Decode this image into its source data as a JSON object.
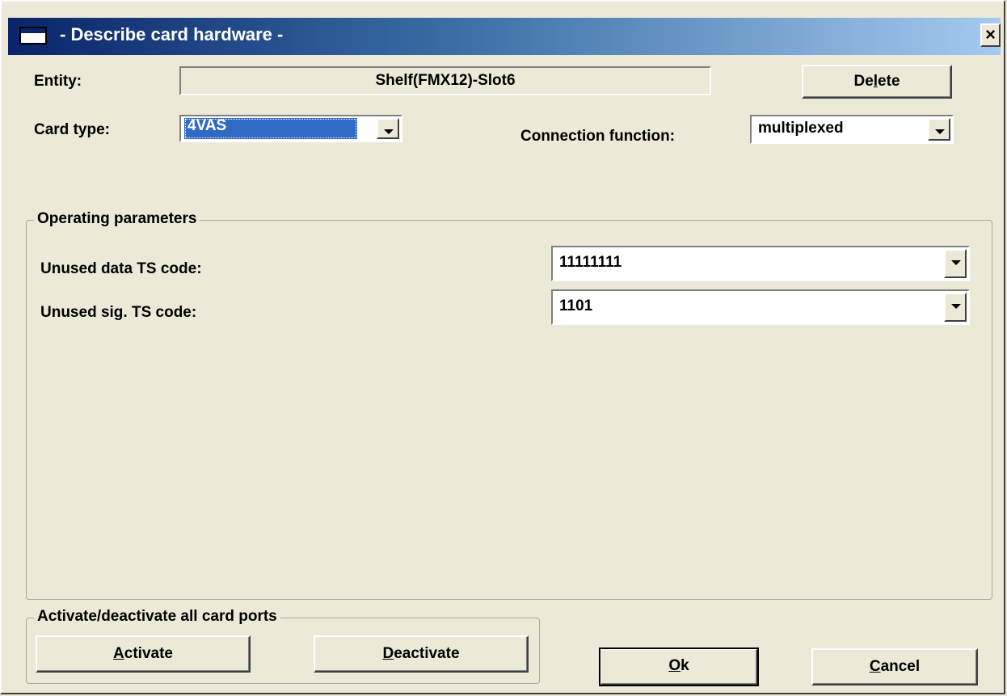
{
  "window": {
    "title": "- Describe card hardware -",
    "close_symbol": "×"
  },
  "entity": {
    "label": "Entity:",
    "value": "Shelf(FMX12)-Slot6"
  },
  "delete_button": {
    "prefix": "De",
    "mnemonic": "l",
    "suffix": "ete"
  },
  "card_type": {
    "label": "Card type:",
    "value": "4VAS"
  },
  "connection_function": {
    "label": "Connection function:",
    "value": "multiplexed"
  },
  "operating_parameters": {
    "title": "Operating parameters",
    "unused_data_ts": {
      "label": "Unused data TS code:",
      "value": "11111111"
    },
    "unused_sig_ts": {
      "label": "Unused sig. TS code:",
      "value": "1101"
    }
  },
  "ports_group": {
    "title": "Activate/deactivate all card ports",
    "activate": {
      "mnemonic": "A",
      "rest": "ctivate"
    },
    "deactivate": {
      "mnemonic": "D",
      "rest": "eactivate"
    }
  },
  "ok_button": {
    "mnemonic": "O",
    "rest": "k"
  },
  "cancel_button": {
    "mnemonic": "C",
    "rest": "ancel"
  },
  "colors": {
    "title_start": "#0a246a",
    "title_end": "#a6caf0",
    "face": "#ece9d8",
    "selection": "#316ac5"
  }
}
